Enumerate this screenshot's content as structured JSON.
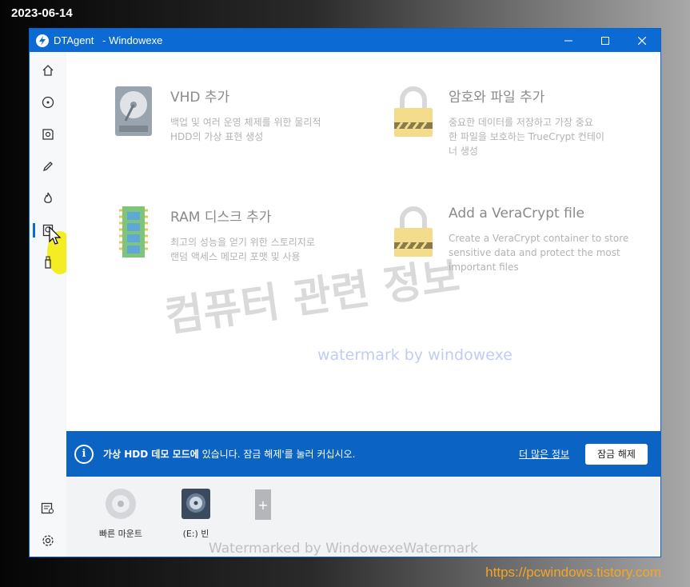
{
  "date_stamp": "2023-06-14",
  "site_url": "https://pcwindows.tistory.com",
  "window": {
    "app_name": "DTAgent",
    "title_suffix": "   - Windowexe"
  },
  "sidebar": {
    "items": [
      {
        "name": "home-icon"
      },
      {
        "name": "disc-icon"
      },
      {
        "name": "disc-image-icon"
      },
      {
        "name": "pencil-icon"
      },
      {
        "name": "flame-icon"
      },
      {
        "name": "virtual-hdd-icon",
        "active": true
      },
      {
        "name": "usb-icon"
      }
    ],
    "bottom": [
      {
        "name": "log-icon"
      },
      {
        "name": "settings-icon"
      }
    ]
  },
  "cards": [
    {
      "title": "VHD 추가",
      "desc1": "백업 및 여러 운영 체제를 위한 물리적",
      "desc2": "HDD의 가상 표현 생성",
      "desc3": ""
    },
    {
      "title": "암호와 파일 추가",
      "desc1": "중요한 데이터를 저장하고 가장 중요",
      "desc2": "한 파일을 보호하는 TrueCrypt 컨테이",
      "desc3": "너 생성"
    },
    {
      "title": "RAM 디스크 추가",
      "desc1": "최고의 성능을 얻기 위한 스토리지로",
      "desc2": "랜덤 액세스 메모리 포맷 및 사용",
      "desc3": ""
    },
    {
      "title": "Add a VeraCrypt file",
      "desc1": "Create a VeraCrypt container to store",
      "desc2": "sensitive data and protect the most",
      "desc3": "important files"
    }
  ],
  "banner": {
    "bold": "가상 HDD 데모 모드에",
    "text": " 있습니다. 잠금 해제'를 눌러 커십시오.",
    "link": "더 많은 정보",
    "button": "잠금 해제"
  },
  "drives": [
    {
      "label": "빠른 마운트"
    },
    {
      "label": "(E:) 빈"
    }
  ],
  "watermarks": {
    "korean": "컴퓨터 관련 정보",
    "by": "watermark by windowexe",
    "bottom": "Watermarked by WindowexeWatermark"
  }
}
